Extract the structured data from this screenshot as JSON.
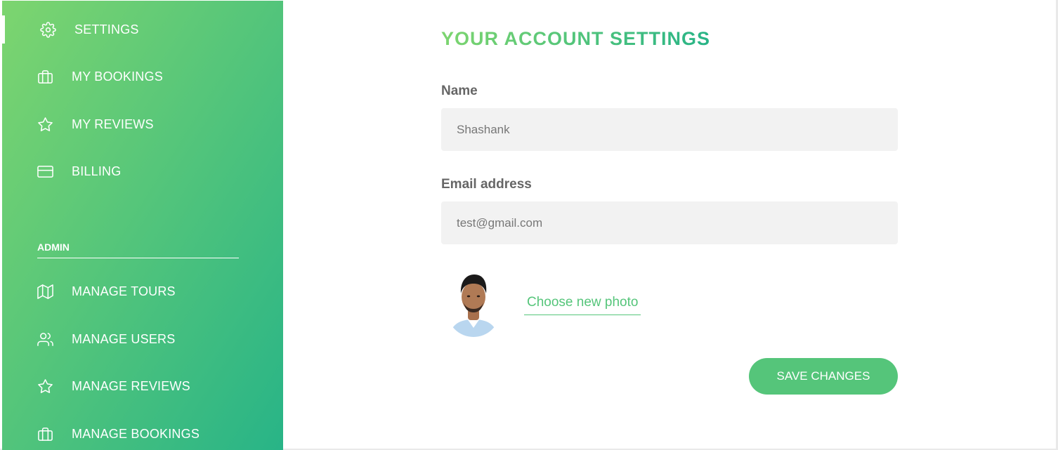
{
  "sidebar": {
    "user_items": [
      {
        "label": "SETTINGS",
        "icon": "settings-icon",
        "active": true
      },
      {
        "label": "MY BOOKINGS",
        "icon": "briefcase-icon"
      },
      {
        "label": "MY REVIEWS",
        "icon": "star-icon"
      },
      {
        "label": "BILLING",
        "icon": "credit-card-icon"
      }
    ],
    "admin_heading": "ADMIN",
    "admin_items": [
      {
        "label": "MANAGE TOURS",
        "icon": "map-icon"
      },
      {
        "label": "MANAGE USERS",
        "icon": "users-icon"
      },
      {
        "label": "MANAGE REVIEWS",
        "icon": "star-icon"
      },
      {
        "label": "MANAGE BOOKINGS",
        "icon": "briefcase-icon"
      }
    ]
  },
  "main": {
    "title": "YOUR ACCOUNT SETTINGS",
    "name_label": "Name",
    "name_value": "Shashank",
    "email_label": "Email address",
    "email_value": "test@gmail.com",
    "choose_photo_label": "Choose new photo",
    "save_label": "SAVE CHANGES"
  },
  "colors": {
    "accent": "#55c57a",
    "gradient_start": "#7dd56f",
    "gradient_end": "#28b487",
    "input_bg": "#f2f2f2",
    "label_text": "#666666"
  }
}
